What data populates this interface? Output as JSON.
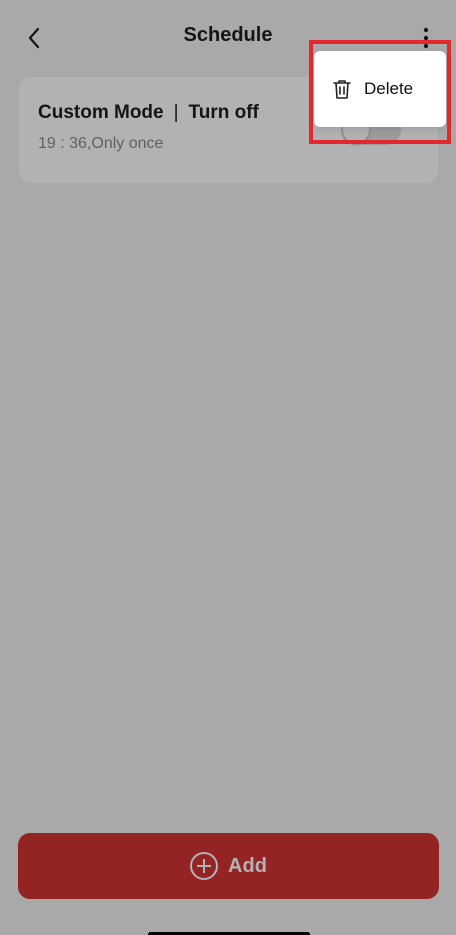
{
  "header": {
    "title": "Schedule",
    "back_icon": "chevron-left-icon",
    "more_icon": "more-vertical-icon"
  },
  "schedule_items": [
    {
      "mode": "Custom Mode",
      "separator": "|",
      "action": "Turn off",
      "time_info": "19 : 36,Only once",
      "enabled": false
    }
  ],
  "footer": {
    "add_label": "Add",
    "add_icon": "plus-circle-icon"
  },
  "popup_menu": {
    "items": [
      {
        "label": "Delete",
        "icon": "trash-icon"
      }
    ]
  },
  "colors": {
    "primary": "#d43333",
    "background": "#f3f3f3",
    "highlight": "#e5262c"
  }
}
